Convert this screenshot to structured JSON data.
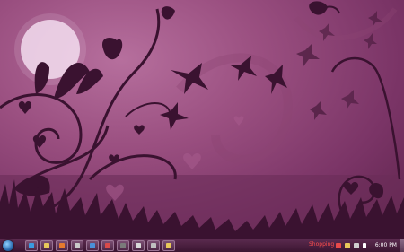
{
  "wallpaper": {
    "theme": "purple-floral-silhouette",
    "colors": {
      "sky_light": "#b66f9d",
      "sky_dark": "#5a2248",
      "moon": "#f3dcef",
      "silhouette": "#3a1230"
    }
  },
  "taskbar": {
    "tray_label": "Shopping",
    "clock": "6:00 PM",
    "pinned_apps": [
      {
        "name": "start-orb"
      },
      {
        "name": "ie-icon",
        "color": "#3a9be0"
      },
      {
        "name": "explorer-icon",
        "color": "#e8c85a"
      },
      {
        "name": "media-player-icon",
        "color": "#e57a2e"
      },
      {
        "name": "app-icon-1",
        "color": "#c9c9c9"
      },
      {
        "name": "app-icon-2",
        "color": "#4a90d9"
      },
      {
        "name": "app-icon-3",
        "color": "#d94a4a"
      },
      {
        "name": "app-icon-4",
        "color": "#7a7a7a"
      },
      {
        "name": "app-icon-5",
        "color": "#d9d9d9"
      },
      {
        "name": "app-icon-6",
        "color": "#bfbfbf"
      },
      {
        "name": "app-icon-7",
        "color": "#e8c85a"
      }
    ]
  }
}
